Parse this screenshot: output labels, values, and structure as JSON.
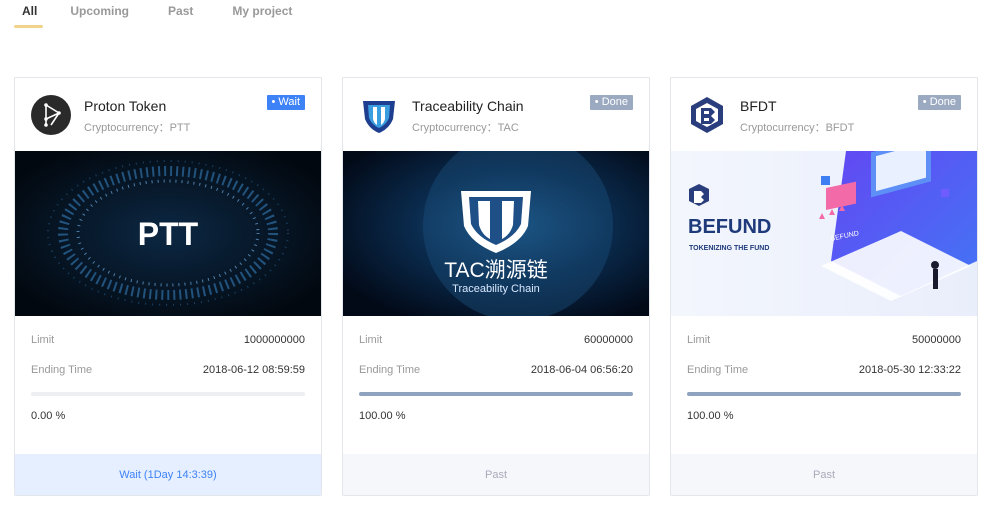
{
  "tabs": [
    {
      "label": "All",
      "active": true
    },
    {
      "label": "Upcoming",
      "active": false
    },
    {
      "label": "Past",
      "active": false
    },
    {
      "label": "My project",
      "active": false
    }
  ],
  "cards": [
    {
      "name": "Proton Token",
      "category": "Cryptocurrency：PTT",
      "badge": "• Wait",
      "banner_text": "PTT",
      "limit_label": "Limit",
      "limit_value": "1000000000",
      "ending_label": "Ending Time",
      "ending_value": "2018-06-12 08:59:59",
      "progress": 0,
      "progress_text": "0.00 %",
      "footer": "Wait (1Day 14:3:39)"
    },
    {
      "name": "Traceability Chain",
      "category": "Cryptocurrency：TAC",
      "badge": "• Done",
      "banner_title": "TAC溯源链",
      "banner_sub": "Traceability Chain",
      "limit_label": "Limit",
      "limit_value": "60000000",
      "ending_label": "Ending Time",
      "ending_value": "2018-06-04 06:56:20",
      "progress": 1,
      "progress_text": "100.00 %",
      "footer": "Past"
    },
    {
      "name": "BFDT",
      "category": "Cryptocurrency：BFDT",
      "badge": "• Done",
      "banner_title": "BEFUND",
      "banner_sub": "TOKENIZING THE FUND",
      "banner_tag": "BEFUND",
      "limit_label": "Limit",
      "limit_value": "50000000",
      "ending_label": "Ending Time",
      "ending_value": "2018-05-30 12:33:22",
      "progress": 1,
      "progress_text": "100.00 %",
      "footer": "Past"
    }
  ],
  "colors": {
    "accent": "#3e82f7",
    "done": "#9baac0",
    "tab_underline": "#f0d48b"
  }
}
